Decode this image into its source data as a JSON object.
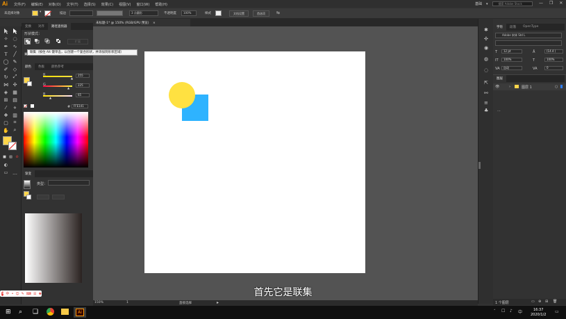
{
  "app": {
    "logo": "Ai",
    "menus": [
      "文件(F)",
      "编辑(E)",
      "对象(O)",
      "文字(T)",
      "选择(S)",
      "效果(C)",
      "视图(V)",
      "窗口(W)",
      "帮助(H)"
    ],
    "workspace": "基础",
    "search_placeholder": "搜索 Adobe Stock",
    "window_buttons": [
      "—",
      "❐",
      "✕"
    ]
  },
  "control_bar": {
    "selection_label": "未选择对象",
    "fill_color": "#ffd54a",
    "stroke_label": "描边",
    "brush_label": "3 点圆形",
    "opacity_label": "不透明度",
    "opacity_value": "100%",
    "style_label": "样式",
    "doc_setup_button": "文档设置",
    "preferences_button": "首选项"
  },
  "document_tab": {
    "title": "未标题-1* @ 150% (RGB/GPU 预览)",
    "close": "×"
  },
  "pathfinder_panel": {
    "tabs": [
      "变换",
      "对齐",
      "路径查找器"
    ],
    "active_tab": "路径查找器",
    "section_label": "形状模式：",
    "expand_button": "扩展",
    "tooltip": "联集（按住 Alt 键单击，以创建一个复合形状，并添加到形状区域）"
  },
  "color_panel": {
    "tabs": [
      "颜色",
      "色板",
      "颜色参考"
    ],
    "channels": [
      {
        "label": "R",
        "value": "255",
        "color": "#e53935",
        "position": 1.0
      },
      {
        "label": "G",
        "value": "225",
        "color": "#43a047",
        "position": 0.88
      },
      {
        "label": "B",
        "value": "65",
        "color": "#1e88e5",
        "position": 0.25
      }
    ],
    "hex_label": "#",
    "hex_value": "FFE141"
  },
  "gradient_panel": {
    "tab": "渐变",
    "type_label": "类型："
  },
  "right_panels": {
    "character_tabs": [
      "字符",
      "段落",
      "OpenType"
    ],
    "font_name": "Adobe 宋体 Std L",
    "font_size": "12 pt",
    "leading": "(14.4 )",
    "scale_h": "100%",
    "scale_v": "100%",
    "tracking": "自动",
    "kerning": "0",
    "layers_tab": "图层",
    "layer_name": "图层 1",
    "layer_count": "1 个图层"
  },
  "status_bar": {
    "zoom": "150%",
    "page": "1",
    "tool_name": "直接选择"
  },
  "taskbar": {
    "time": "16:37",
    "date": "2020/1/2"
  },
  "shapes": {
    "circle_color": "#ffe141",
    "square_color": "#2eb3ff"
  },
  "subtitle": "首先它是联集",
  "ime_bar": [
    "中",
    "•",
    "☺",
    "✎",
    "⌨",
    "☰",
    "♚",
    "⁂"
  ]
}
